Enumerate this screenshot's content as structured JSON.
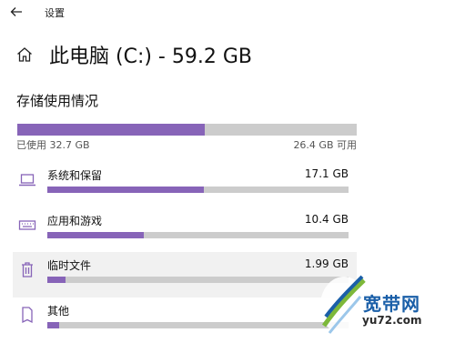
{
  "window": {
    "title": "设置",
    "back_icon": "back-arrow-icon"
  },
  "header": {
    "icon": "home-icon",
    "title": "此电脑 (C:) - 59.2 GB"
  },
  "storage": {
    "section_title": "存储使用情况",
    "used_label": "已使用 32.7 GB",
    "free_label": "26.4 GB 可用",
    "used_fraction": 0.552
  },
  "categories": [
    {
      "icon": "laptop-icon",
      "label": "系统和保留",
      "size": "17.1 GB",
      "fraction": 0.52
    },
    {
      "icon": "keyboard-icon",
      "label": "应用和游戏",
      "size": "10.4 GB",
      "fraction": 0.32
    },
    {
      "icon": "trash-icon",
      "label": "临时文件",
      "size": "1.99 GB",
      "fraction": 0.06
    },
    {
      "icon": "document-icon",
      "label": "其他",
      "size": "",
      "fraction": 0.04
    }
  ],
  "colors": {
    "accent": "#8764b8",
    "track": "#cccccc",
    "hover": "#f1f1f1"
  },
  "watermark": {
    "name": "宽带网",
    "url": "yu72.com"
  }
}
